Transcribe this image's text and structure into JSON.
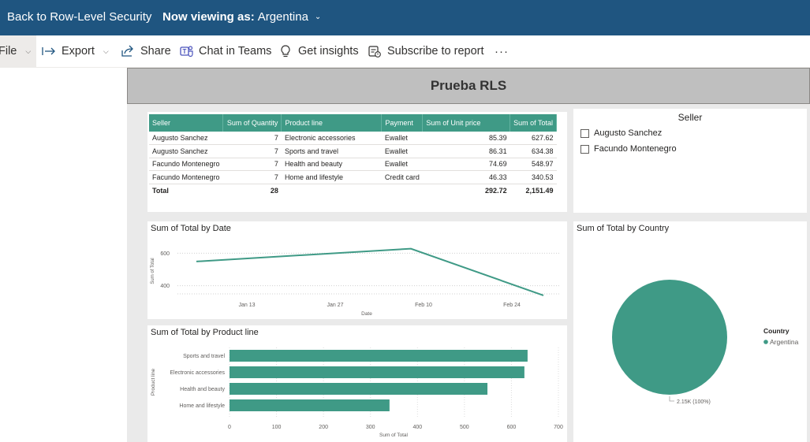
{
  "topbar": {
    "back_label": "Back to Row-Level Security",
    "viewing_prefix": "Now viewing as:",
    "viewing_value": "Argentina"
  },
  "toolbar": {
    "file_label": "File",
    "export_label": "Export",
    "share_label": "Share",
    "teams_label": "Chat in Teams",
    "insights_label": "Get insights",
    "subscribe_label": "Subscribe to report",
    "more_label": "···"
  },
  "report": {
    "title": "Prueba RLS"
  },
  "table": {
    "columns": [
      "Seller",
      "Sum of Quantity",
      "Product line",
      "Payment",
      "Sum of Unit price",
      "Sum of Total"
    ],
    "rows": [
      [
        "Augusto Sanchez",
        "7",
        "Electronic accessories",
        "Ewallet",
        "85.39",
        "627.62"
      ],
      [
        "Augusto Sanchez",
        "7",
        "Sports and travel",
        "Ewallet",
        "86.31",
        "634.38"
      ],
      [
        "Facundo Montenegro",
        "7",
        "Health and beauty",
        "Ewallet",
        "74.69",
        "548.97"
      ],
      [
        "Facundo Montenegro",
        "7",
        "Home and lifestyle",
        "Credit card",
        "46.33",
        "340.53"
      ]
    ],
    "total": [
      "Total",
      "28",
      "",
      "",
      "292.72",
      "2,151.49"
    ]
  },
  "slicer": {
    "title": "Seller",
    "options": [
      "Augusto Sanchez",
      "Facundo Montenegro"
    ]
  },
  "colors": {
    "accent": "#3f9a86",
    "topbar": "#1f5580"
  },
  "chart_data": [
    {
      "type": "line",
      "title": "Sum of Total by Date",
      "xlabel": "Date",
      "ylabel": "Sum of Total",
      "x_ticks": [
        "Jan 13",
        "Jan 27",
        "Feb 10",
        "Feb 24"
      ],
      "x": [
        "Jan 5",
        "Feb 8",
        "Mar 1"
      ],
      "values": [
        548.97,
        627.62,
        340.53
      ],
      "y_ticks": [
        400,
        600
      ],
      "grid": true
    },
    {
      "type": "bar",
      "title": "Sum of Total by Product line",
      "xlabel": "Sum of Total",
      "ylabel": "Product line",
      "categories": [
        "Sports and travel",
        "Electronic accessories",
        "Health and beauty",
        "Home and lifestyle"
      ],
      "values": [
        634.38,
        627.62,
        548.97,
        340.53
      ],
      "x_ticks": [
        0,
        100,
        200,
        300,
        400,
        500,
        600,
        700
      ],
      "xlim": [
        0,
        700
      ]
    },
    {
      "type": "pie",
      "title": "Sum of Total by Country",
      "legend_title": "Country",
      "categories": [
        "Argentina"
      ],
      "values": [
        2151.49
      ],
      "data_label": "2.15K (100%)",
      "legend_position": "right"
    }
  ]
}
